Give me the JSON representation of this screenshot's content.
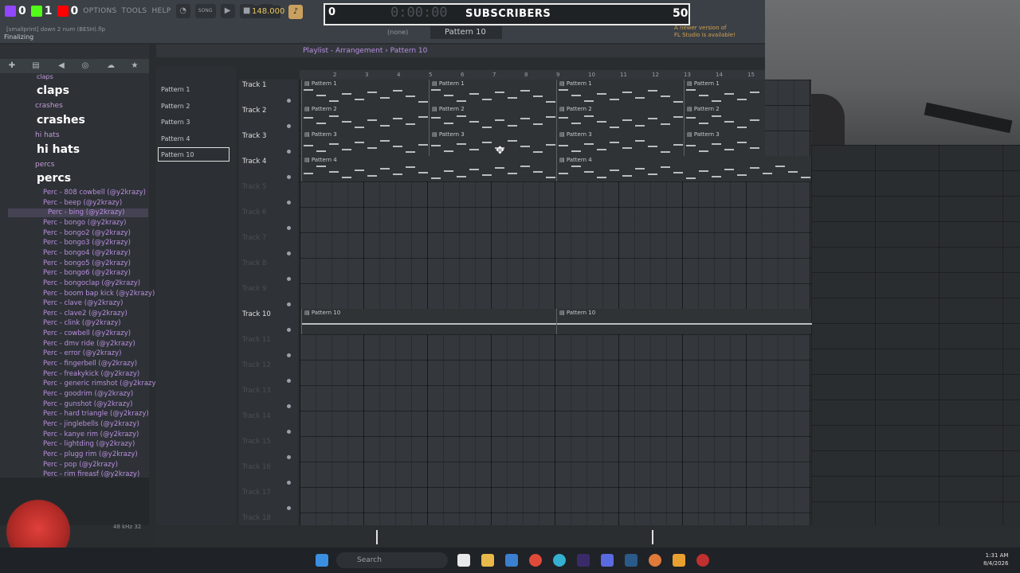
{
  "menu": {
    "brand_counts": [
      "0",
      "0",
      "1",
      "0"
    ],
    "items": [
      "OPTIONS",
      "TOOLS",
      "HELP"
    ],
    "mode": "SONG"
  },
  "topbar": {
    "tempo": "148.000",
    "song_position": "0",
    "time_display": "0:00:00",
    "subscribers_label": "SUBSCRIBERS",
    "subscribers_count": "50",
    "hint": "[smallprint] down 2 num (BESH).flp",
    "status": "Finalizing",
    "pattern_none": "(none)",
    "pattern_selected": "Pattern 10",
    "notice": "A newer version of\nFL Studio is available!"
  },
  "browser": {
    "folders": [
      "claps",
      "crashes",
      "hi hats",
      "percs"
    ],
    "big_labels": [
      "claps",
      "crashes",
      "hi hats",
      "percs"
    ],
    "samples": [
      "Perc - 808 cowbell (@y2krazy)",
      "Perc - beep (@y2krazy)",
      "Perc - bing (@y2krazy)",
      "Perc - bongo (@y2krazy)",
      "Perc - bongo2 (@y2krazy)",
      "Perc - bongo3 (@y2krazy)",
      "Perc - bongo4 (@y2krazy)",
      "Perc - bongo5 (@y2krazy)",
      "Perc - bongo6 (@y2krazy)",
      "Perc - bongoclap (@y2krazy)",
      "Perc - boom bap kick (@y2krazy)",
      "Perc - clave (@y2krazy)",
      "Perc - clave2 (@y2krazy)",
      "Perc - clink (@y2krazy)",
      "Perc - cowbell (@y2krazy)",
      "Perc - dmv ride (@y2krazy)",
      "Perc - error (@y2krazy)",
      "Perc - fingerbell (@y2krazy)",
      "Perc - freakykick (@y2krazy)",
      "Perc - generic rimshot (@y2krazy)",
      "Perc - goodrim (@y2krazy)",
      "Perc - gunshot (@y2krazy)",
      "Perc - hard triangle (@y2krazy)",
      "Perc - jinglebells (@y2krazy)",
      "Perc - kanye rim (@y2krazy)",
      "Perc - lightding (@y2krazy)",
      "Perc - plugg rim (@y2krazy)",
      "Perc - pop (@y2krazy)",
      "Perc - rim fireasf (@y2krazy)"
    ],
    "freq": "48 kHz 32"
  },
  "picker": [
    "Pattern 1",
    "Pattern 2",
    "Pattern 3",
    "Pattern 4",
    "Pattern 10"
  ],
  "playlist": {
    "title": "Playlist - Arrangement › Pattern 10",
    "ruler": [
      "2",
      "3",
      "4",
      "5",
      "6",
      "7",
      "8",
      "9",
      "10",
      "11",
      "12",
      "13",
      "14",
      "15"
    ],
    "tracks": [
      "Track 1",
      "Track 2",
      "Track 3",
      "Track 4",
      "Track 5",
      "Track 6",
      "Track 7",
      "Track 8",
      "Track 9",
      "Track 10",
      "Track 11",
      "Track 12",
      "Track 13",
      "Track 14",
      "Track 15",
      "Track 16",
      "Track 17",
      "Track 18"
    ],
    "clip_labels": [
      "Pattern 1",
      "Pattern 2",
      "Pattern 3",
      "Pattern 4",
      "Pattern 10"
    ]
  },
  "taskbar": {
    "search": "Search",
    "time": "1:31 AM",
    "date": "8/4/2026"
  },
  "colors": {
    "accent": "#b98fe0",
    "panel": "#2e3236",
    "grid": "#34383c"
  }
}
